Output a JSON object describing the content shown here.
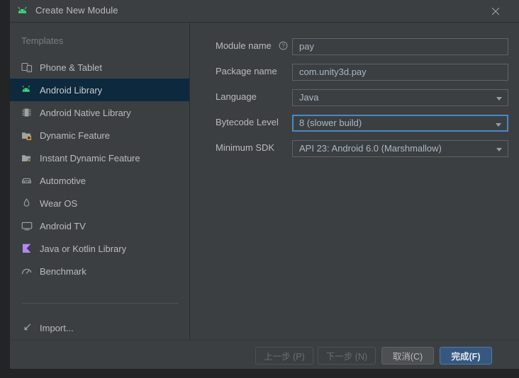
{
  "window": {
    "title": "Create New Module",
    "icon": "android-robot-icon",
    "close_label": "close-icon"
  },
  "sidebar": {
    "header": "Templates",
    "items": [
      {
        "label": "Phone & Tablet",
        "icon": "phone-tablet-icon",
        "selected": false
      },
      {
        "label": "Android Library",
        "icon": "android-robot-icon",
        "selected": true
      },
      {
        "label": "Android Native Library",
        "icon": "native-chip-icon",
        "selected": false
      },
      {
        "label": "Dynamic Feature",
        "icon": "dynamic-feature-folder-icon",
        "selected": false
      },
      {
        "label": "Instant Dynamic Feature",
        "icon": "instant-feature-folder-icon",
        "selected": false
      },
      {
        "label": "Automotive",
        "icon": "car-icon",
        "selected": false
      },
      {
        "label": "Wear OS",
        "icon": "watch-icon",
        "selected": false
      },
      {
        "label": "Android TV",
        "icon": "tv-icon",
        "selected": false
      },
      {
        "label": "Java or Kotlin Library",
        "icon": "kotlin-flag-icon",
        "selected": false
      },
      {
        "label": "Benchmark",
        "icon": "speedometer-icon",
        "selected": false
      }
    ],
    "import_item": {
      "label": "Import...",
      "icon": "import-arrow-icon"
    }
  },
  "form": {
    "fields": [
      {
        "label": "Module name",
        "value": "pay",
        "type": "text",
        "help": true,
        "focused": false
      },
      {
        "label": "Package name",
        "value": "com.unity3d.pay",
        "type": "text",
        "help": false,
        "focused": false
      },
      {
        "label": "Language",
        "value": "Java",
        "type": "combo",
        "help": false,
        "focused": false
      },
      {
        "label": "Bytecode Level",
        "value": "8 (slower build)",
        "type": "combo",
        "help": false,
        "focused": true
      },
      {
        "label": "Minimum SDK",
        "value": "API 23: Android 6.0 (Marshmallow)",
        "type": "combo",
        "help": false,
        "focused": false
      }
    ]
  },
  "footer": {
    "buttons": [
      {
        "label": "上一步 (P)",
        "name": "previous-button",
        "state": "disabled"
      },
      {
        "label": "下一步 (N)",
        "name": "next-button",
        "state": "disabled"
      },
      {
        "label": "取消(C)",
        "name": "cancel-button",
        "state": "normal"
      },
      {
        "label": "完成(F)",
        "name": "finish-button",
        "state": "primary"
      }
    ]
  },
  "colors": {
    "panel_bg": "#3c3f41",
    "selection_bg": "#0d293e",
    "accent_blue": "#4a88c7",
    "primary_button": "#365880",
    "android_green": "#3ddc84",
    "kotlin_purple": "#b388f5",
    "text": "#bbbbbb",
    "value_text": "#a9b7c6"
  }
}
